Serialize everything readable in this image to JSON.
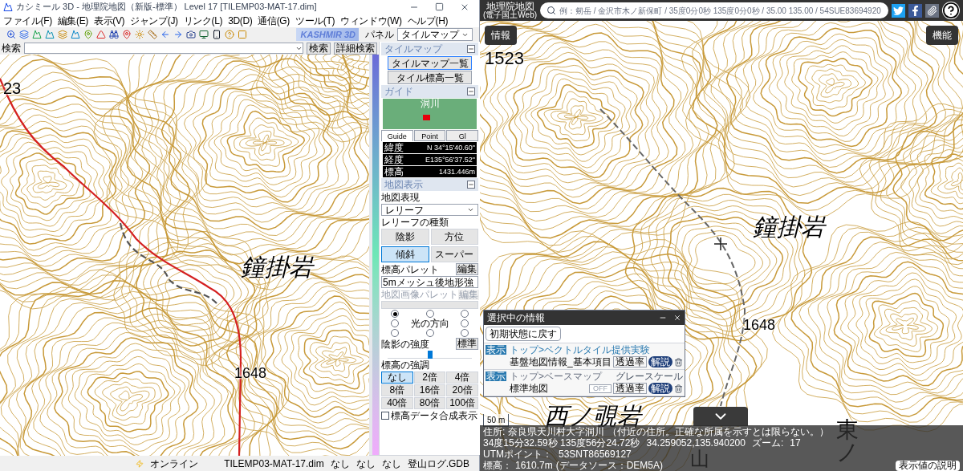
{
  "left_window": {
    "title": "カシミール 3D - 地理院地図（新版-標準） Level 17 [TILEMP03-MAT-17.dim]",
    "menu": [
      "ファイル(F)",
      "編集(E)",
      "表示(V)",
      "ジャンプ(J)",
      "リンク(L)",
      "3D(D)",
      "通信(G)",
      "ツール(T)",
      "ウィンドウ(W)",
      "ヘルプ(H)"
    ],
    "logo": "KASHMIR 3D",
    "panel_label": "パネル",
    "panel_select": "タイルマップ",
    "search_label": "検索",
    "search_button": "検索",
    "detail_search_button": "詳細検索",
    "map_labels": [
      "23",
      "鐘掛岩",
      "1648"
    ],
    "side_panel": {
      "tilemap": {
        "title": "タイルマップ",
        "buttons": [
          "タイルマップ一覧",
          "タイル標高一覧"
        ]
      },
      "guide": {
        "title": "ガイド",
        "map_label": "洞川",
        "tabs": [
          {
            "label": "Guide",
            "selected": true
          },
          {
            "label": "Point",
            "selected": false
          },
          {
            "label": "Gl",
            "selected": false
          }
        ],
        "readouts": [
          {
            "label": "緯度",
            "value": "N 34°15'40.60\""
          },
          {
            "label": "経度",
            "value": "E135°56'37.52\""
          },
          {
            "label": "標高",
            "value": "1431.446m"
          }
        ]
      },
      "map_display": {
        "title": "地図表示",
        "expression_label": "地図表現",
        "expression_value": "レリーフ",
        "relief_type_label": "レリーフの種類",
        "relief_buttons": [
          {
            "label": "陰影",
            "selected": false
          },
          {
            "label": "方位",
            "selected": false
          },
          {
            "label": "傾斜",
            "selected": true
          },
          {
            "label": "スーパー",
            "selected": false
          }
        ],
        "palette_label": "標高パレット",
        "palette_edit": "編集",
        "palette_value": "5mメッシュ後地形強",
        "image_palette_label": "地図画像パレット",
        "image_palette_edit": "編集",
        "light_direction_label": "光の方向",
        "light_directions": [
          {
            "selected": true
          },
          {
            "selected": false
          },
          {
            "selected": false
          },
          {
            "selected": false
          },
          {
            "selected": false
          },
          {
            "selected": false
          },
          {
            "selected": false
          },
          {
            "selected": false
          }
        ],
        "shade_label": "陰影の強度",
        "shade_standard": "標準",
        "shade_slider": {
          "level": 0.5
        },
        "emphasis_label": "標高の強調",
        "emphasis": [
          {
            "label": "なし",
            "selected": true
          },
          {
            "label": "2倍",
            "selected": false
          },
          {
            "label": "4倍",
            "selected": false
          },
          {
            "label": "8倍",
            "selected": false
          },
          {
            "label": "16倍",
            "selected": false
          },
          {
            "label": "20倍",
            "selected": false
          },
          {
            "label": "40倍",
            "selected": false
          },
          {
            "label": "80倍",
            "selected": false
          },
          {
            "label": "100倍",
            "selected": false
          }
        ],
        "composite": {
          "label": "標高データ合成表示",
          "checked": false
        }
      }
    },
    "status_bar": {
      "online": "オンライン",
      "file": "TILEMP03-MAT-17.dim",
      "fields": [
        "なし",
        "なし",
        "なし",
        "登山ログ.GDB"
      ]
    }
  },
  "right_window": {
    "title": "地理院地図",
    "subtitle": "(電子国土Web)",
    "search_placeholder": "例：剱岳 / 金沢市木ノ新保町 / 35度0分0秒 135度0分0秒 / 35.00 135.00 / 54SUE83694920",
    "info_button": "情報",
    "function_button": "機能",
    "map_labels": [
      "1523",
      "鐘掛岩",
      "1648",
      "西ノ覗岩",
      "山",
      "東ノ"
    ],
    "scale": "50 m",
    "layer_panel": {
      "title": "選択中の情報",
      "reset_button": "初期状態に戻す",
      "layers": [
        {
          "badge": "表示",
          "path": "トップ>ベクトルタイル提供実験",
          "name": "基盤地図情報_基本項目",
          "opacity_button": "透過率",
          "info_button": "解説"
        },
        {
          "badge": "表示",
          "path": "トップ>ベースマップ",
          "name": "標準地図",
          "grayscale": {
            "label": "グレースケール",
            "value": "OFF",
            "on": false
          },
          "opacity_button": "透過率",
          "info_button": "解説"
        }
      ]
    },
    "info_bar": {
      "address_label": "住所:",
      "address": "奈良県天川村大字洞川",
      "address_note": "（付近の住所。正確な所属を示すとは限らない。）",
      "dms": "34度15分32.59秒 135度56分24.72秒",
      "decimal": "34.259052,135.940200",
      "zoom_label": "ズーム:",
      "zoom": "17",
      "utm_label": "UTMポイント：",
      "utm": "53SNT86569127",
      "elevation_label": "標高：",
      "elevation": "1610.7m",
      "elevation_source": "(データソース：DEM5A)",
      "explain_button": "表示値の説明"
    }
  }
}
